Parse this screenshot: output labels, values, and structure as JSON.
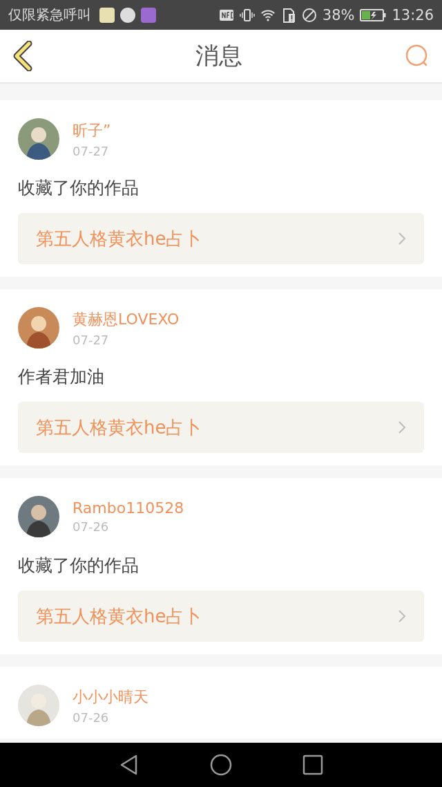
{
  "status_bar": {
    "notice": "仅限紧急呼叫",
    "battery": "38%",
    "time": "13:26"
  },
  "header": {
    "title": "消息"
  },
  "messages": [
    {
      "name": "昕子”",
      "date": "07-27",
      "text": "收藏了你的作品",
      "work": "第五人格黄衣he占卜"
    },
    {
      "name": "黄赫恩LOVEXO",
      "date": "07-27",
      "text": "作者君加油",
      "work": "第五人格黄衣he占卜"
    },
    {
      "name": "Rambo110528",
      "date": "07-26",
      "text": "收藏了你的作品",
      "work": "第五人格黄衣he占卜"
    },
    {
      "name": "小小小晴天",
      "date": "07-26"
    }
  ]
}
